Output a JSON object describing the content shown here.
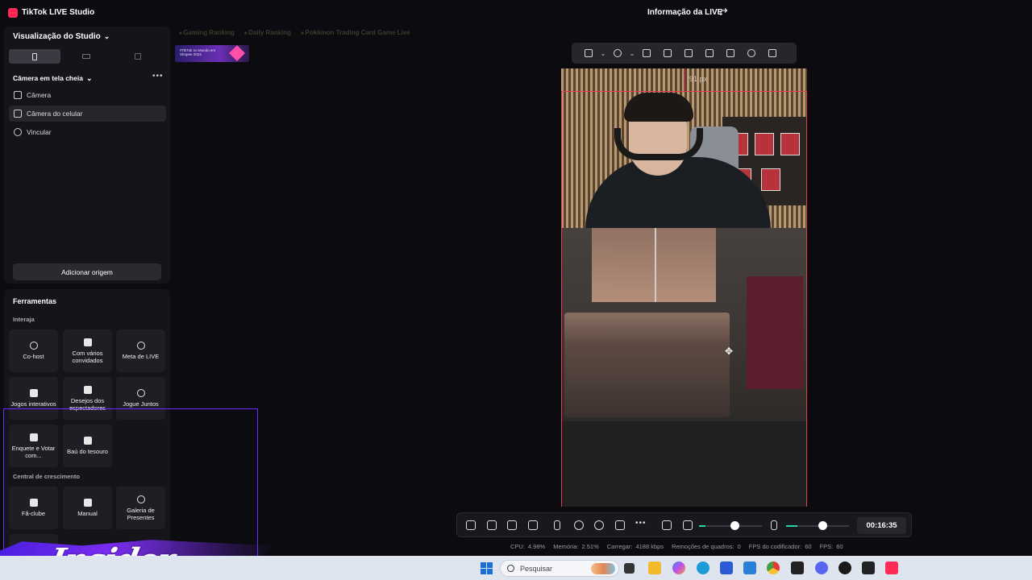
{
  "app": {
    "title": "TikTok LIVE Studio",
    "live_info": "Informação da LIVE"
  },
  "studio": {
    "title": "Visualização do Studio",
    "scene": "Câmera em tela cheia",
    "sources": [
      {
        "label": "Câmera",
        "icon": "camera-icon"
      },
      {
        "label": "Câmera do celular",
        "icon": "phone-camera-icon"
      },
      {
        "label": "Vincular",
        "icon": "globe-icon"
      }
    ],
    "add_source": "Adicionar origem"
  },
  "tools": {
    "title": "Ferramentas",
    "section_interact": "Interaja",
    "section_growth": "Central de crescimento",
    "items": [
      {
        "label": "Co-host"
      },
      {
        "label": "Com vários convidados"
      },
      {
        "label": "Meta de LIVE"
      },
      {
        "label": "Jogos interativos"
      },
      {
        "label": "Desejos dos espectadores"
      },
      {
        "label": "Jogue Juntos"
      },
      {
        "label": "Enquete e Votar com..."
      },
      {
        "label": "Baú do tesouro"
      },
      {
        "label": "Fã-clube"
      },
      {
        "label": "Manual"
      },
      {
        "label": "Galeria de Presentes"
      }
    ]
  },
  "rankings": {
    "gaming": "Gaming Ranking",
    "daily": "Daily Ranking",
    "game": "Pokémon Trading Card Game Live"
  },
  "banner": {
    "text": "#TikTok no Mundo em Shopee 2024"
  },
  "canvas": {
    "offset_label": "91 px"
  },
  "timer": "00:16:35",
  "status": {
    "cpu_label": "CPU:",
    "cpu": "4.98%",
    "mem_label": "Memória:",
    "mem": "2.51%",
    "upload_label": "Carregar:",
    "upload": "4188 kbps",
    "drop_label": "Remoções de quadros:",
    "drop": "0",
    "enc_label": "FPS do codificador:",
    "enc": "60",
    "fps_label": "FPS:",
    "fps": "60"
  },
  "taskbar": {
    "search_placeholder": "Pesquisar"
  },
  "overlay": {
    "watermark": "Insider"
  },
  "colors": {
    "accent": "#fe2c55",
    "selection": "#e83a52",
    "mic_level": "#23d7a2",
    "frame": "#6a2cff"
  }
}
